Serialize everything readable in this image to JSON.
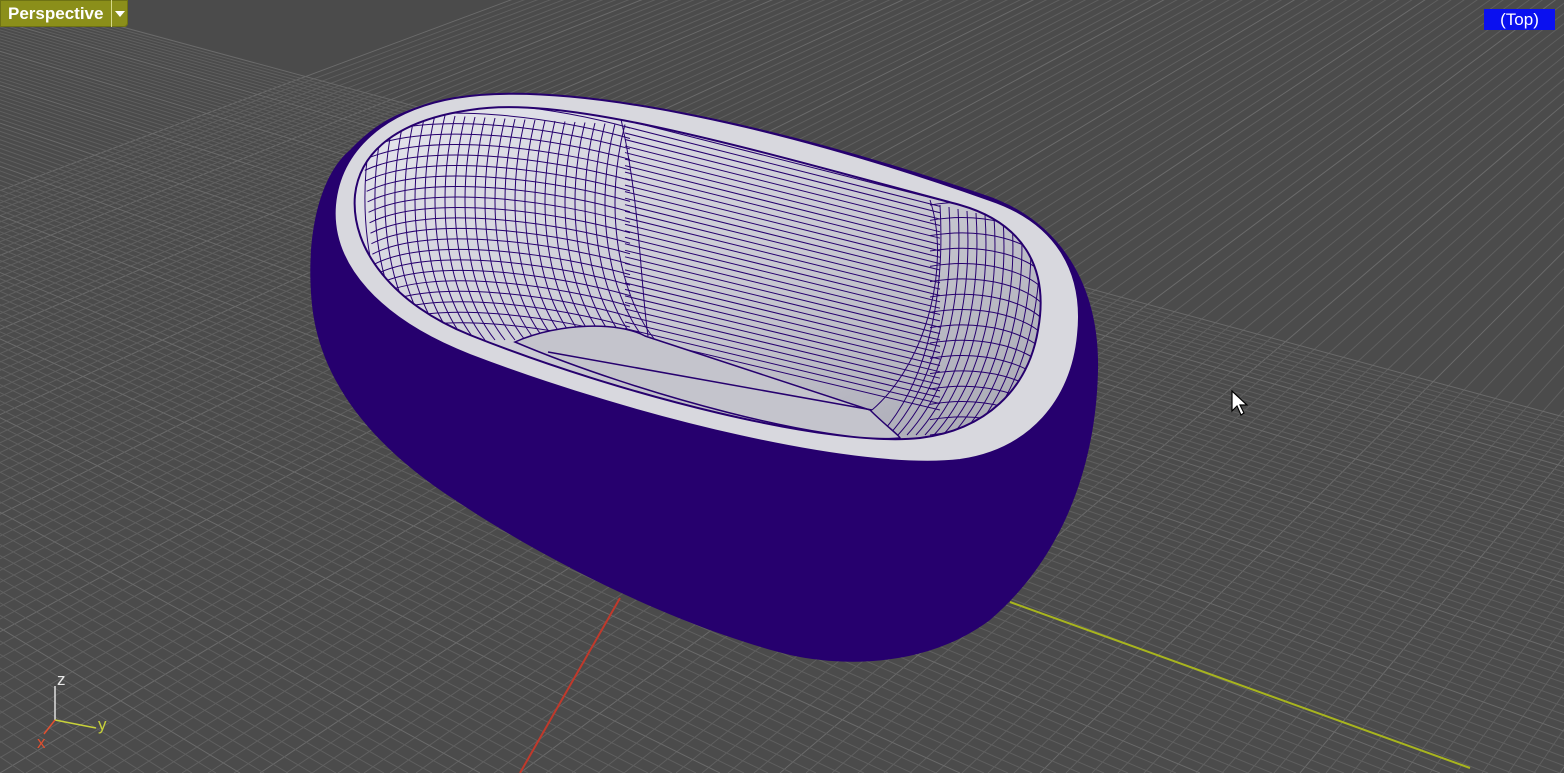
{
  "viewport": {
    "title": "Perspective",
    "view_badge": "(Top)",
    "colors": {
      "background": "#4b4b4b",
      "grid_line": "#5f5f5f",
      "grid_major": "#6a6a6a",
      "x_axis": "#c0392b",
      "y_axis": "#a8b51e",
      "tab_background": "#8b8f1a",
      "badge_background": "#0a10f0",
      "object_wire": "#26006e",
      "object_surface": "#c9c9cf"
    },
    "icons": {
      "dropdown": "chevron-down-icon",
      "cursor": "mouse-pointer-icon"
    }
  },
  "axis_gizmo": {
    "z_label": "z",
    "y_label": "y",
    "x_label": "x"
  }
}
